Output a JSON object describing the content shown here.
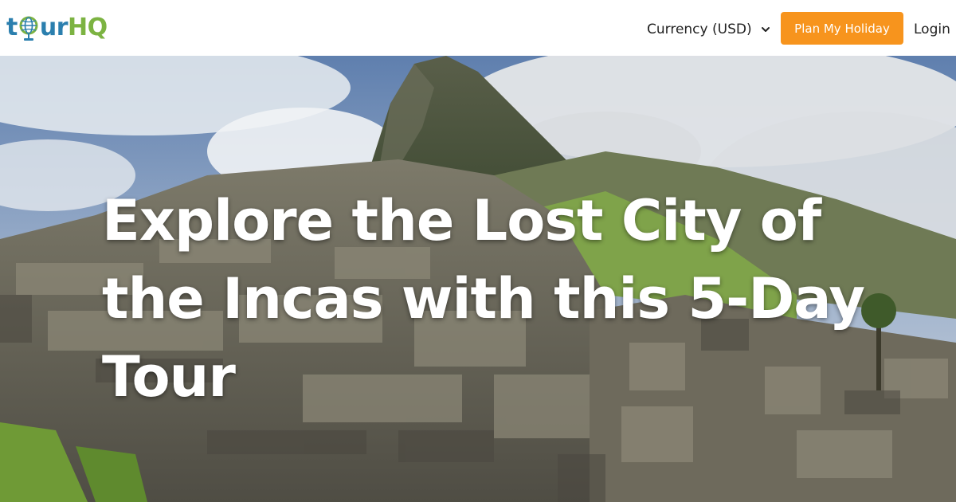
{
  "brand": {
    "logo_text_part1": "t",
    "logo_text_part2": "ur",
    "logo_text_part3": "HQ",
    "logo_color_blue": "#2b7fae",
    "logo_color_green": "#7cb342"
  },
  "header": {
    "currency_label": "Currency (USD)",
    "currency_icon": "chevron-down-icon",
    "plan_button_label": "Plan My Holiday",
    "plan_button_color": "#f7941d",
    "login_label": "Login"
  },
  "hero": {
    "title": "Explore the Lost City of the Incas with this 5-Day Tour",
    "image_subject": "machu-picchu-photo"
  }
}
